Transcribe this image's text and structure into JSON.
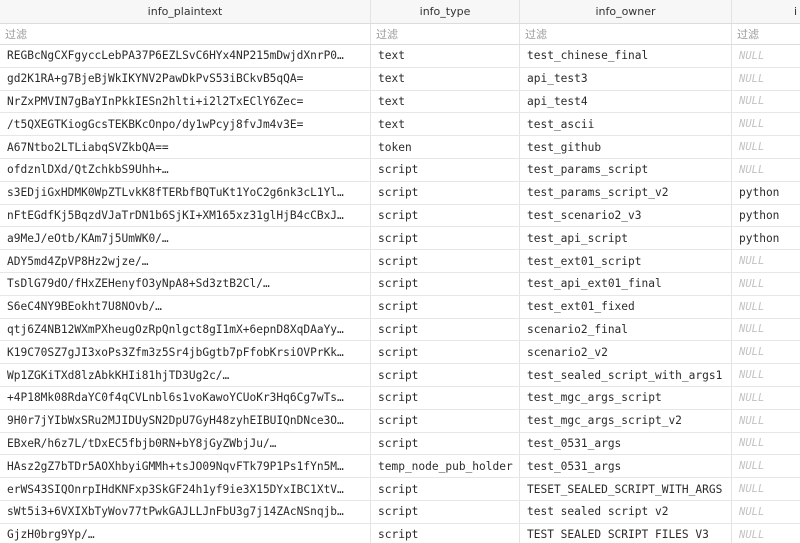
{
  "columns": [
    "info_plaintext",
    "info_type",
    "info_owner",
    "i"
  ],
  "filter_placeholder": "过滤",
  "rows": [
    [
      "REGBcNgCXFgyccLebPA37P6EZLSvC6HYx4NP215mDwjdXnrP0…",
      "text",
      "test_chinese_final",
      "NULL"
    ],
    [
      "gd2K1RA+g7BjeBjWkIKYNV2PawDkPvS53iBCkvB5qQA=",
      "text",
      "api_test3",
      "NULL"
    ],
    [
      "NrZxPMVIN7gBaYInPkkIESn2hlti+i2l2TxEClY6Zec=",
      "text",
      "api_test4",
      "NULL"
    ],
    [
      "/t5QXEGTKiogGcsTEKBKcOnpo/dy1wPcyj8fvJm4v3E=",
      "text",
      "test_ascii",
      "NULL"
    ],
    [
      "A67Ntbo2LTLiabqSVZkbQA==",
      "token",
      "test_github",
      "NULL"
    ],
    [
      "ofdznlDXd/QtZchkbS9Uhh+…",
      "script",
      "test_params_script",
      "NULL"
    ],
    [
      "s3EDjiGxHDMK0WpZTLvkK8fTERbfBQTuKt1YoC2g6nk3cL1Yl…",
      "script",
      "test_params_script_v2",
      "python"
    ],
    [
      "nFtEGdfKj5BqzdVJaTrDN1b6SjKI+XM165xz31glHjB4cCBxJ…",
      "script",
      "test_scenario2_v3",
      "python"
    ],
    [
      "a9MeJ/eOtb/KAm7j5UmWK0/…",
      "script",
      "test_api_script",
      "python"
    ],
    [
      "ADY5md4ZpVP8Hz2wjze/…",
      "script",
      "test_ext01_script",
      "NULL"
    ],
    [
      "TsDlG79dO/fHxZEHenyfO3yNpA8+Sd3ztB2Cl/…",
      "script",
      "test_api_ext01_final",
      "NULL"
    ],
    [
      "S6eC4NY9BEokht7U8NOvb/…",
      "script",
      "test_ext01_fixed",
      "NULL"
    ],
    [
      "qtj6Z4NB12WXmPXheugOzRpQnlgct8gI1mX+6epnD8XqDAaYy…",
      "script",
      "scenario2_final",
      "NULL"
    ],
    [
      "K19C70SZ7gJI3xoPs3Zfm3z5Sr4jbGgtb7pFfobKrsiOVPrKk…",
      "script",
      "scenario2_v2",
      "NULL"
    ],
    [
      "Wp1ZGKiTXd8lzAbkKHIi81hjTD3Ug2c/…",
      "script",
      "test_sealed_script_with_args1",
      "NULL"
    ],
    [
      "+4P18Mk08RdaYC0f4qCVLnbl6s1voKawoYCUoKr3Hq6Cg7wTs…",
      "script",
      "test_mgc_args_script",
      "NULL"
    ],
    [
      "9H0r7jYIbWxSRu2MJIDUySN2DpU7GyH48zyhEIBUIQnDNce3O…",
      "script",
      "test_mgc_args_script_v2",
      "NULL"
    ],
    [
      "EBxeR/h6z7L/tDxEC5fbjb0RN+bY8jGyZWbjJu/…",
      "script",
      "test_0531_args",
      "NULL"
    ],
    [
      "HAsz2gZ7bTDr5AOXhbyiGMMh+tsJO09NqvFTk79P1Ps1fYn5M…",
      "temp_node_pub_holder",
      "test_0531_args",
      "NULL"
    ],
    [
      "erWS43SIQOnrpIHdKNFxp3SkGF24h1yf9ie3X15DYxIBC1XtV…",
      "script",
      "TESET_SEALED_SCRIPT_WITH_ARGS",
      "NULL"
    ],
    [
      "sWt5i3+6VXIXbTyWov77tPwkGAJLLJnFbU3g7j14ZAcNSnqjb…",
      "script",
      "test sealed script v2",
      "NULL"
    ],
    [
      "GjzH0brg9Yp/…",
      "script",
      "TEST SEALED SCRIPT FILES V3",
      "NULL"
    ]
  ]
}
